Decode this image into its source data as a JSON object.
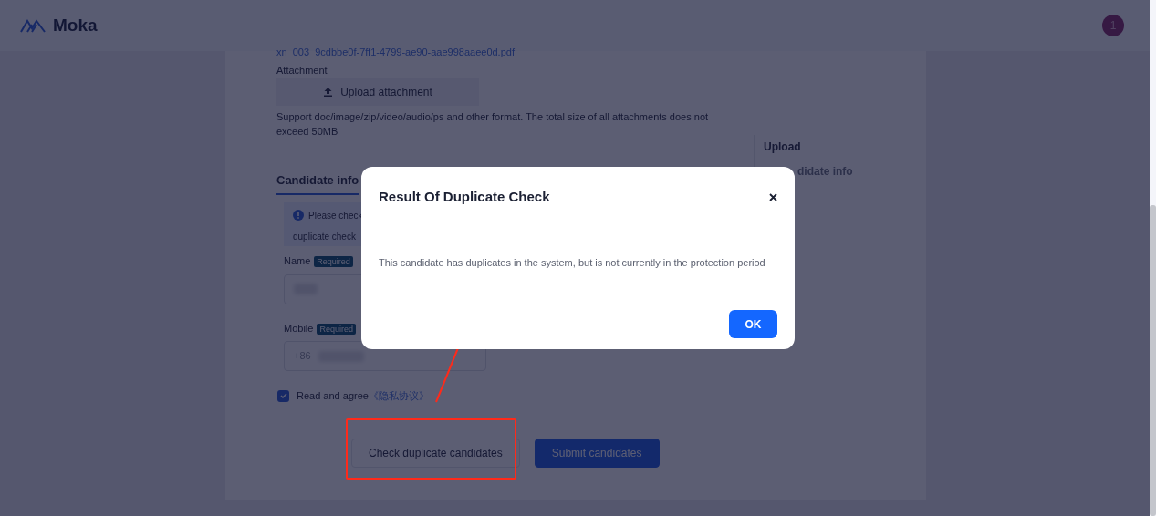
{
  "header": {
    "logo": "Moka",
    "avatar": "1"
  },
  "form": {
    "file_link": "xn_003_9cdbbe0f-7ff1-4799-ae90-aae998aaee0d.pdf",
    "attachment_label": "Attachment",
    "upload_button": "Upload attachment",
    "upload_hint": "Support doc/image/zip/video/audio/ps and other format. The total size of all attachments does not exceed 50MB",
    "section_title": "Candidate info",
    "notice_lines": [
      "Please check",
      "duplicate check"
    ],
    "fields": [
      {
        "label": "Name",
        "badge": "Required"
      },
      {
        "label": "Mobile",
        "badge": "Required",
        "prefix": "+86"
      }
    ],
    "agreement": {
      "checked": true,
      "text": "Read and agree",
      "link": "《隐私协议》"
    },
    "buttons": [
      {
        "label": "Check duplicate candidates",
        "kind": "secondary"
      },
      {
        "label": "Submit candidates",
        "kind": "primary"
      }
    ]
  },
  "side_nav": [
    {
      "label": "Upload",
      "selected": true
    },
    {
      "label": "didate info",
      "selected": false
    }
  ],
  "dialog": {
    "title": "Result Of Duplicate Check",
    "message": "This candidate has duplicates in the system, but is not currently in the protection period",
    "ok": "OK"
  }
}
